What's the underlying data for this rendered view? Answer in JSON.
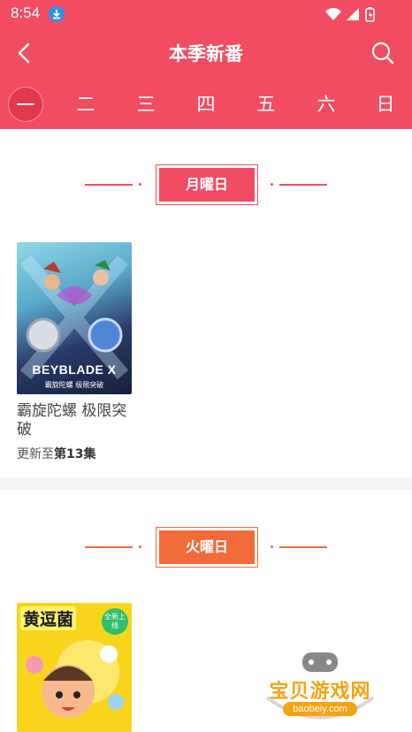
{
  "status": {
    "time": "8:54"
  },
  "header": {
    "title": "本季新番"
  },
  "weekdays": [
    "一",
    "二",
    "三",
    "四",
    "五",
    "六",
    "日"
  ],
  "active_day_index": 0,
  "sections": [
    {
      "label": "月曜日",
      "color": "#f24c62",
      "items": [
        {
          "title": "霸旋陀螺 极限突破",
          "episode_prefix": "更新至",
          "episode": "第13集",
          "cover_text": "BEYBLADE X",
          "cover_subtext": "霸旋陀螺 极限突破"
        }
      ]
    },
    {
      "label": "火曜日",
      "color": "#f26b3a",
      "items": [
        {
          "cover_text": "黄逗菌",
          "cover_badge": "全新上线"
        }
      ]
    }
  ],
  "watermark": {
    "text": "宝贝游戏网",
    "url": "baobeiy.com"
  }
}
